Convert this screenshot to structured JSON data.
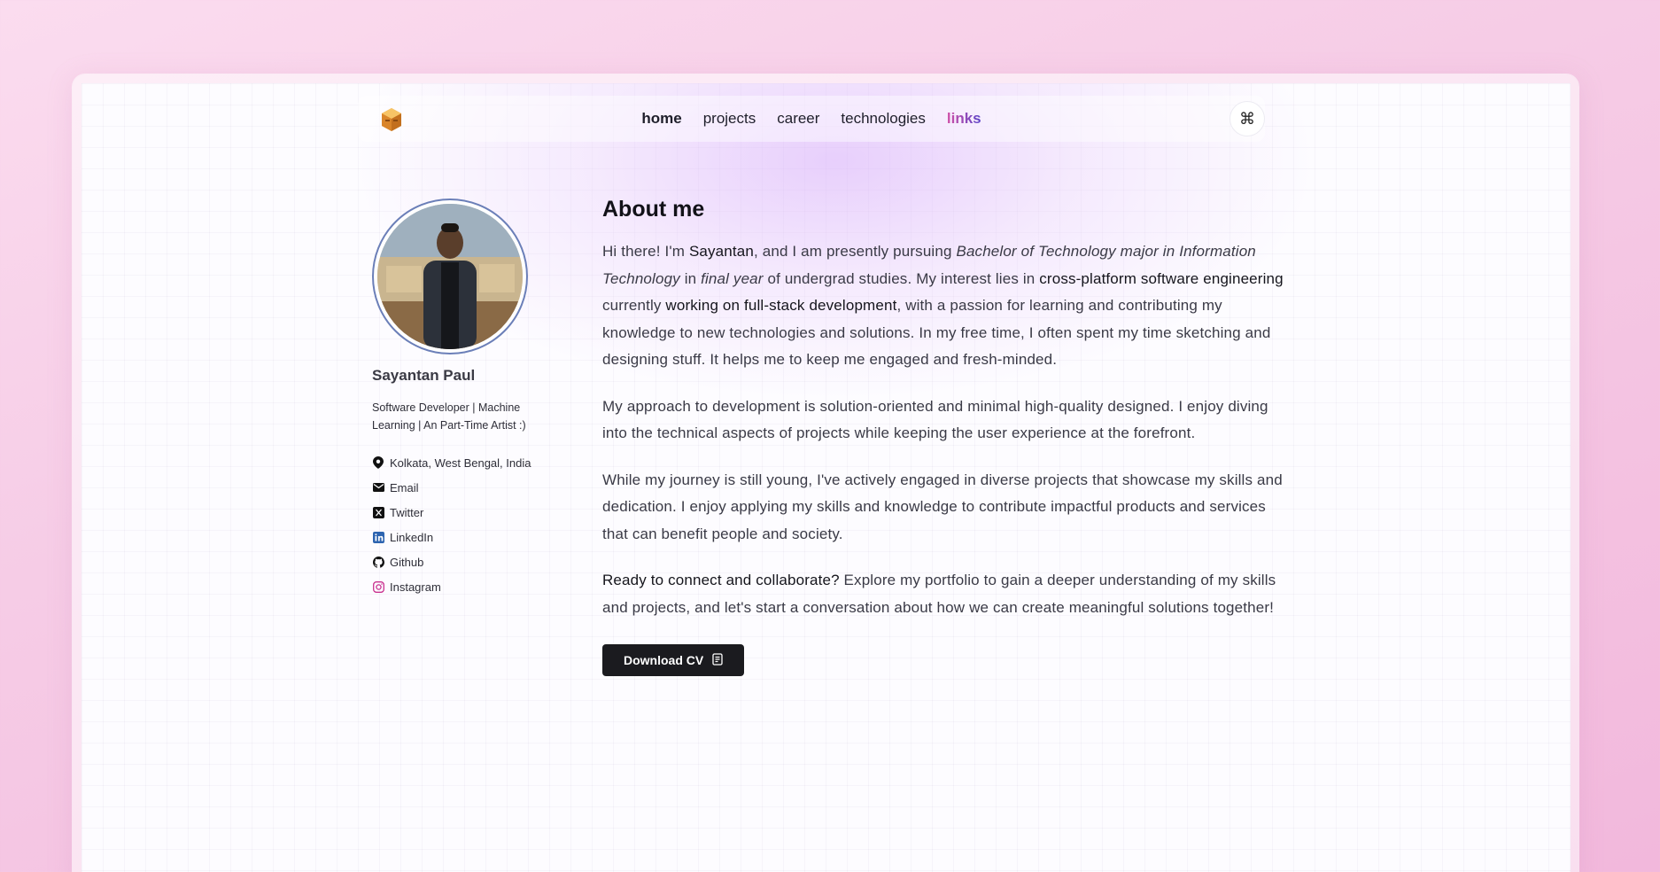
{
  "nav": {
    "items": [
      {
        "label": "home",
        "active": true
      },
      {
        "label": "projects"
      },
      {
        "label": "career"
      },
      {
        "label": "technologies"
      },
      {
        "label": "links",
        "accent": true
      }
    ],
    "command_label": "⌘"
  },
  "profile": {
    "name": "Sayantan Paul",
    "tagline": "Software Developer | Machine Learning | An Part-Time Artist :)",
    "location": "Kolkata, West Bengal, India",
    "links": [
      {
        "label": "Email",
        "icon": "mail-icon"
      },
      {
        "label": "Twitter",
        "icon": "x-twitter-icon"
      },
      {
        "label": "LinkedIn",
        "icon": "linkedin-icon"
      },
      {
        "label": "Github",
        "icon": "github-icon"
      },
      {
        "label": "Instagram",
        "icon": "instagram-icon"
      }
    ]
  },
  "about": {
    "heading": "About me",
    "p1": {
      "t1": "Hi there! I'm ",
      "name": "Sayantan",
      "t2": ", and I am presently pursuing ",
      "degree": "Bachelor of Technology major in Information Technology",
      "t3": " in ",
      "year": "final year",
      "t4": " of undergrad studies. My interest lies in ",
      "interest": "cross-platform software engineering",
      "t5": " currently ",
      "current": "working on full-stack development",
      "t6": ", with a passion for learning and contributing my knowledge to new technologies and solutions. In my free time, I often spent my time sketching and designing stuff. It helps me to keep me engaged and fresh-minded."
    },
    "p2": "My approach to development is solution-oriented and minimal high-quality designed. I enjoy diving into the technical aspects of projects while keeping the user experience at the forefront.",
    "p3": "While my journey is still young, I've actively engaged in diverse projects that showcase my skills and dedication. I enjoy applying my skills and knowledge to contribute impactful products and services that can benefit people and society.",
    "p4": {
      "lead": "Ready to connect and collaborate?",
      "rest": " Explore my portfolio to gain a deeper understanding of my skills and projects, and let's start a conversation about how we can create meaningful solutions together!"
    },
    "cv_button": "Download CV"
  },
  "colors": {
    "accent_gradient_start": "#d14fa6",
    "accent_gradient_end": "#5a45c9",
    "button_bg": "#1b1b1f",
    "logo_orange": "#e8902a"
  }
}
